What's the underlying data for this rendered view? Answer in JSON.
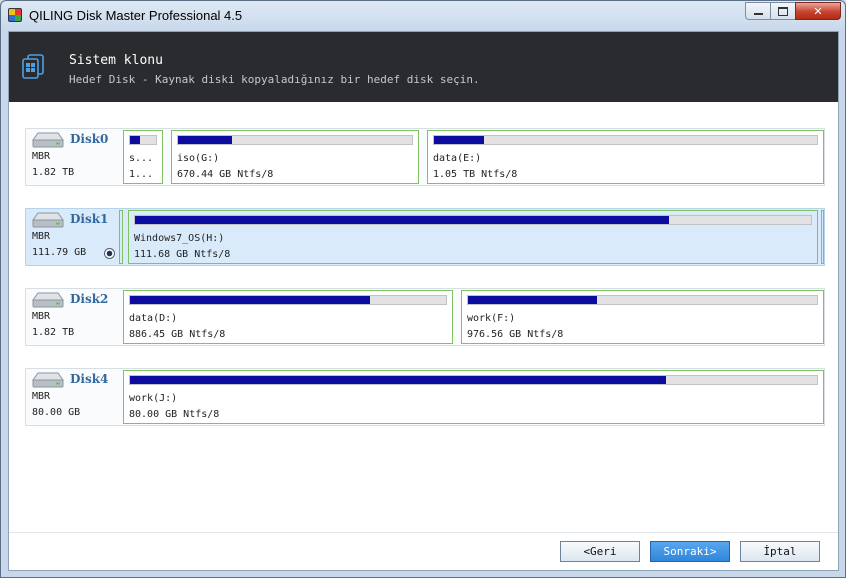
{
  "window": {
    "title": "QILING Disk Master Professional 4.5",
    "close_glyph": "✕"
  },
  "header": {
    "title": "Sistem klonu",
    "subtitle": "Hedef Disk - Kaynak diski kopyaladığınız bir hedef disk seçin."
  },
  "disks": [
    {
      "name": "Disk0",
      "type": "MBR",
      "size": "1.82 TB",
      "selected": false,
      "partitions": [
        {
          "label": "s...",
          "detail": "1...",
          "used": 0.4
        },
        {
          "label": "iso(G:)",
          "detail": "670.44 GB Ntfs/8",
          "used": 0.23
        },
        {
          "label": "data(E:)",
          "detail": "1.05 TB Ntfs/8",
          "used": 0.13
        }
      ]
    },
    {
      "name": "Disk1",
      "type": "MBR",
      "size": "111.79 GB",
      "selected": true,
      "partitions": [
        {
          "label": "Windows7_OS(H:)",
          "detail": "111.68 GB Ntfs/8",
          "used": 0.79
        }
      ]
    },
    {
      "name": "Disk2",
      "type": "MBR",
      "size": "1.82 TB",
      "selected": false,
      "partitions": [
        {
          "label": "data(D:)",
          "detail": "886.45 GB Ntfs/8",
          "used": 0.76
        },
        {
          "label": "work(F:)",
          "detail": "976.56 GB Ntfs/8",
          "used": 0.37
        }
      ]
    },
    {
      "name": "Disk4",
      "type": "MBR",
      "size": "80.00 GB",
      "selected": false,
      "partitions": [
        {
          "label": "work(J:)",
          "detail": "80.00 GB Ntfs/8",
          "used": 0.78
        }
      ]
    }
  ],
  "footer": {
    "back_label": "<Geri",
    "next_label": "Sonraki>",
    "cancel_label": "İptal"
  },
  "colors": {
    "header_bg": "#2a2b2e",
    "partition_border": "#7fc261",
    "usage_fill": "#0c0ca0",
    "selected_row": "#d9ebfa",
    "primary_button": "#2f86db"
  }
}
